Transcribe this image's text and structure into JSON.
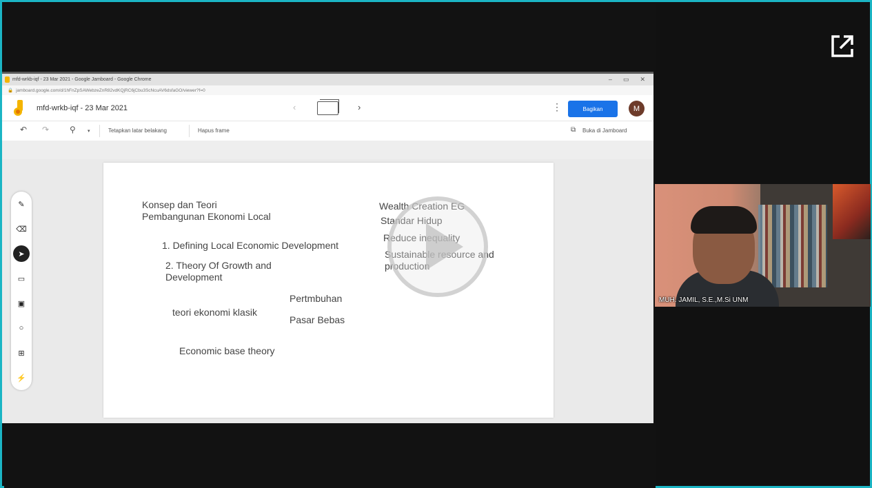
{
  "browser": {
    "window_title": "mfd-wrkb-iqf - 23 Mar 2021 - Google Jamboard - Google Chrome",
    "url": "jamboard.google.com/d/1hFnZpSAWebzeZnR82vdKQjRC6jCbu3ScNcuAV6dsfaGO/viewer?f=0",
    "min": "–",
    "restore": "▭",
    "close": "✕"
  },
  "jamboard": {
    "title": "mfd-wrkb-iqf - 23 Mar 2021",
    "share_label": "Bagikan",
    "avatar_initial": "M",
    "toolbar": {
      "undo": "↶",
      "redo": "↷",
      "zoom": "⚲",
      "zoom_caret": "▾",
      "set_background": "Tetapkan latar belakang",
      "clear_frame": "Hapus frame",
      "open_in_jamboard": "Buka di Jamboard"
    },
    "board_text": {
      "heading_line1": "Konsep dan Teori",
      "heading_line2": "Pembangunan Ekonomi Local",
      "item1": "1. Defining Local Economic Development",
      "item2_line1": "2. Theory Of Growth and",
      "item2_line2": "Development",
      "classical": "teori ekonomi klasik",
      "growth": "Pertmbuhan",
      "free_market": "Pasar Bebas",
      "base_theory": "Economic base theory",
      "wealth": "Wealth Creation    EG",
      "living_standard": "Standar Hidup",
      "reduce": "Reduce inequality",
      "sustainable_line1": "Sustainable resource and",
      "sustainable_line2": "production"
    }
  },
  "participant": {
    "name": "MUH. JAMIL, S.E.,M.Si UNM"
  },
  "colors": {
    "frame_border": "#1bb5c4",
    "share_button": "#1a73e8"
  }
}
